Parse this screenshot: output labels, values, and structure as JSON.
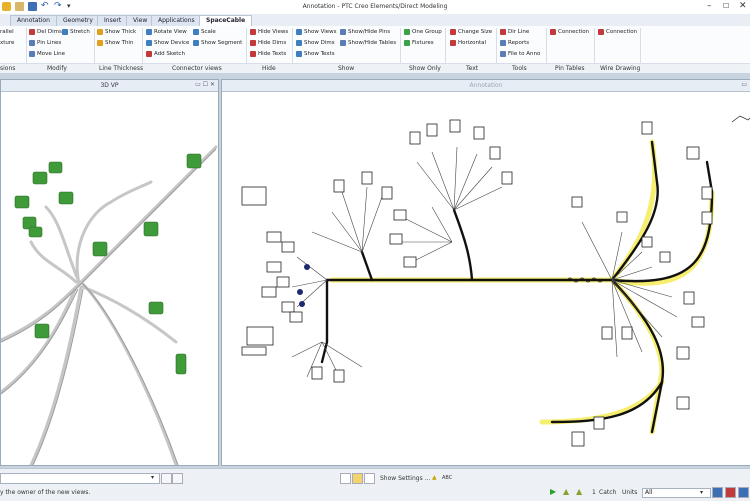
{
  "window": {
    "title": "Annotation - PTC Creo Elements/Direct Modeling"
  },
  "tabs": [
    {
      "label": "Annotation"
    },
    {
      "label": "Geometry"
    },
    {
      "label": "Insert"
    },
    {
      "label": "View"
    },
    {
      "label": "Applications"
    },
    {
      "label": "SpaceCable"
    }
  ],
  "ribbon": {
    "items": {
      "parallel": "rallel",
      "fixture": "xture",
      "del_dims": "Del Dims",
      "pin_lines": "Pin Lines",
      "move_line": "Move Line",
      "stretch": "Stretch",
      "show_thick": "Show Thick",
      "show_thin": "Show Thin",
      "rotate_view": "Rotate View",
      "scale": "Scale",
      "show_device": "Show Device",
      "show_segment": "Show Segment",
      "add_sketch": "Add Sketch",
      "hide_views": "Hide Views",
      "hide_dims": "Hide Dims",
      "hide_texts": "Hide Texts",
      "show_views": "Show Views",
      "show_dims": "Show Dims",
      "show_texts": "Show Texts",
      "show_hide_pins": "Show/Hide Pins",
      "show_hide_tables": "Show/Hide Tables",
      "one_group": "One Group",
      "fixtures": "Fixtures",
      "change_size": "Change Size",
      "horizontal": "Horizontal",
      "dir_line": "Dir Line",
      "reports": "Reports",
      "file_to_anno": "File to Anno",
      "connection_1": "Connection",
      "connection_2": "Connection"
    },
    "groups": {
      "sions": "sions",
      "modify": "Modify",
      "line_thickness": "Line Thickness",
      "connector_views": "Connector views",
      "hide": "Hide",
      "show": "Show",
      "show_only": "Show Only",
      "text": "Text",
      "tools": "Tools",
      "pin_tables": "Pin Tables",
      "wire_drawing": "Wire Drawing"
    }
  },
  "viewports": {
    "left_title": "3D VP",
    "right_title": "Annotation"
  },
  "status": {
    "prompt": "y the owner of the new views.",
    "show_settings": "Show Settings ...",
    "catch_count": "1",
    "catch_label": "Catch",
    "units_label": "Units",
    "units_value": "All",
    "abc": "ABC"
  },
  "colors": {
    "accent": "#1f5fa8",
    "wire": "#111111",
    "highlight": "#f5ea4a",
    "part_green": "#3f9a3a"
  }
}
